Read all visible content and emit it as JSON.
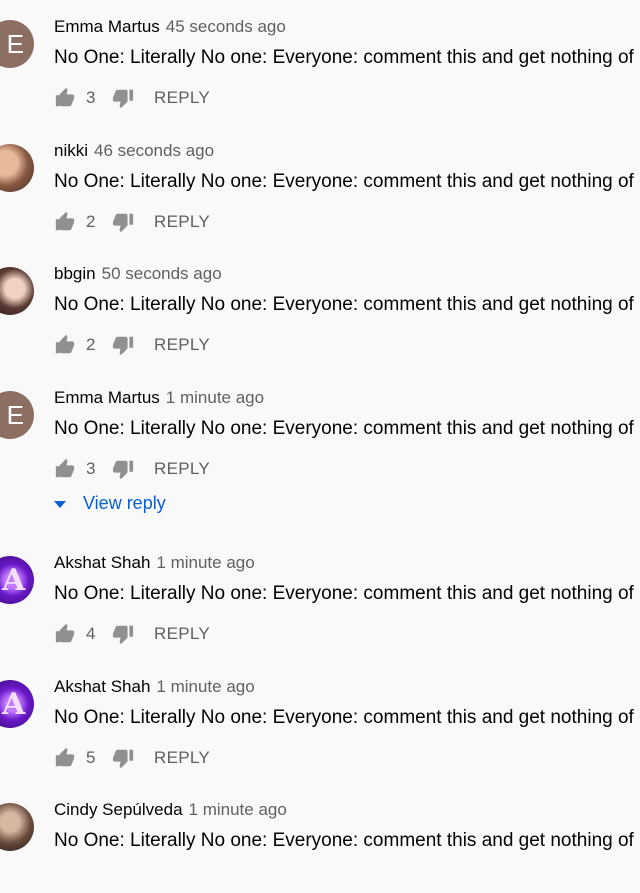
{
  "comments": [
    {
      "author": "Emma Martus",
      "time": "45 seconds ago",
      "text": "No One: Literally No one: Everyone: comment this and get nothing of like",
      "likes": "3",
      "avatar": "E",
      "reply_label": "REPLY"
    },
    {
      "author": "nikki",
      "time": "46 seconds ago",
      "text": "No One: Literally No one: Everyone: comment this and get nothing of like",
      "likes": "2",
      "reply_label": "REPLY"
    },
    {
      "author": "bbgin",
      "time": "50 seconds ago",
      "text": "No One: Literally No one: Everyone: comment this and get nothing of like",
      "likes": "2",
      "reply_label": "REPLY"
    },
    {
      "author": "Emma Martus",
      "time": "1 minute ago",
      "text": "No One: Literally No one: Everyone: comment this and get nothing of like",
      "likes": "3",
      "avatar": "E",
      "reply_label": "REPLY"
    },
    {
      "author": "Akshat Shah",
      "time": "1 minute ago",
      "text": "No One: Literally No one: Everyone: comment this and get nothing of like",
      "likes": "4",
      "reply_label": "REPLY"
    },
    {
      "author": "Akshat Shah",
      "time": "1 minute ago",
      "text": "No One: Literally No one: Everyone: comment this and get nothing of like",
      "likes": "5",
      "reply_label": "REPLY"
    },
    {
      "author": "Cindy Sepúlveda",
      "time": "1 minute ago",
      "text": "No One: Literally No one: Everyone: comment this and get nothing of like"
    }
  ],
  "view_reply_label": "View reply",
  "icons": {
    "like": "thumb-up-icon",
    "dislike": "thumb-down-icon",
    "expand": "caret-down-icon"
  },
  "colors": {
    "link": "#065fd4",
    "secondary_text": "#606060",
    "background": "#f9f9f9"
  }
}
